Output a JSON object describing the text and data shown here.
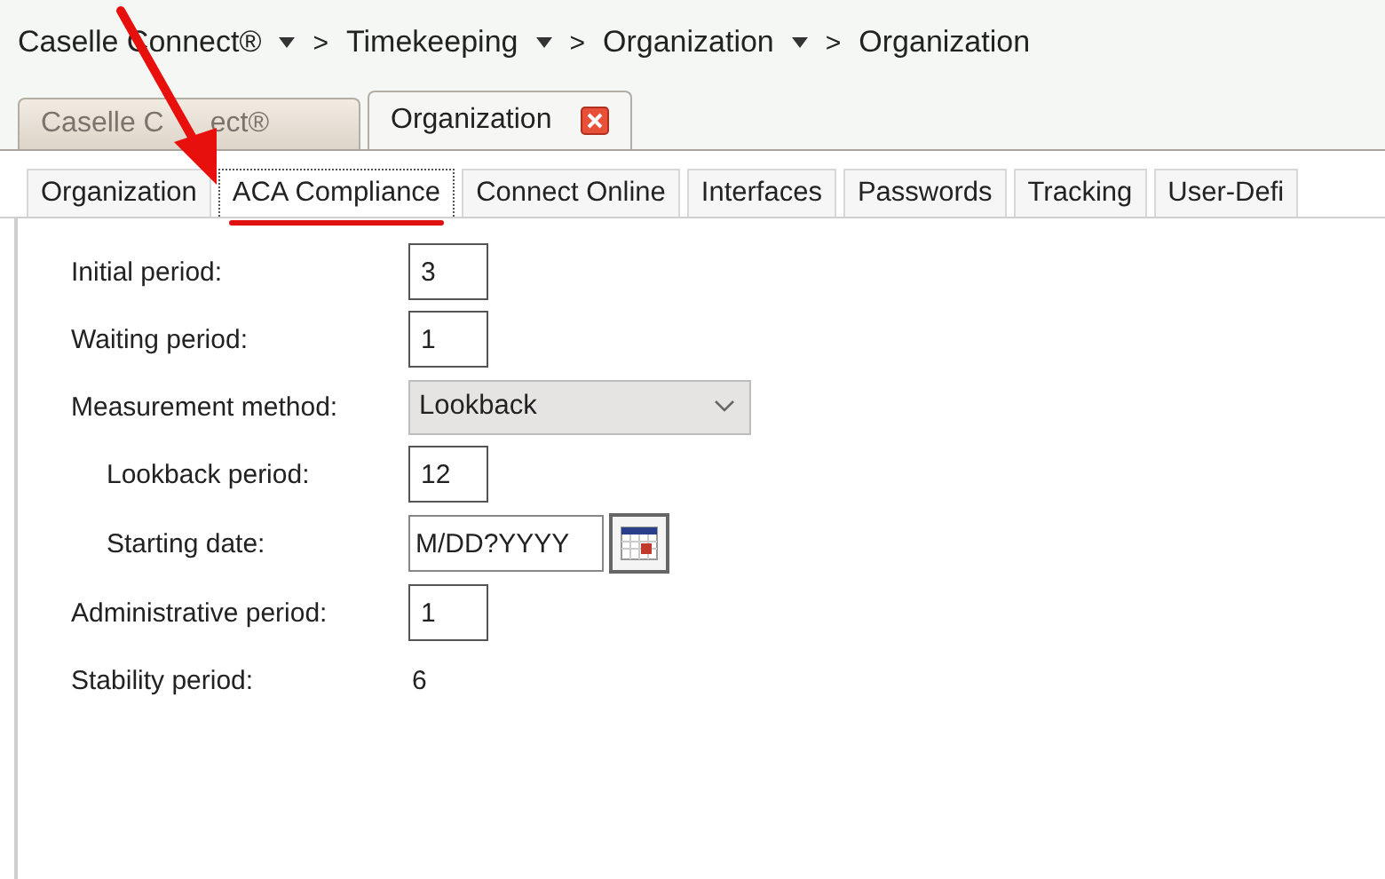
{
  "breadcrumb": [
    {
      "label": "Caselle Connect®",
      "menu": true,
      "separator": ">"
    },
    {
      "label": "Timekeeping",
      "menu": true,
      "separator": ">"
    },
    {
      "label": "Organization",
      "menu": true,
      "separator": ">"
    },
    {
      "label": "Organization",
      "menu": false
    }
  ],
  "document_tabs": [
    {
      "label_parts": [
        "Caselle C",
        "ect®"
      ],
      "selected": false,
      "closable": false
    },
    {
      "label": "Organization",
      "selected": true,
      "closable": true
    }
  ],
  "tabs": [
    {
      "label": "Organization",
      "selected": false,
      "highlighted": false
    },
    {
      "label": "ACA Compliance",
      "selected": true,
      "highlighted": true
    },
    {
      "label": "Connect Online",
      "selected": false,
      "highlighted": false
    },
    {
      "label": "Interfaces",
      "selected": false,
      "highlighted": false
    },
    {
      "label": "Passwords",
      "selected": false,
      "highlighted": false
    },
    {
      "label": "Tracking",
      "selected": false,
      "highlighted": false
    },
    {
      "label": "User-Defi",
      "selected": false,
      "highlighted": false
    }
  ],
  "form": [
    {
      "kind": "text",
      "label": "Initial period:",
      "value": "3"
    },
    {
      "kind": "text",
      "label": "Waiting period:",
      "value": "1"
    },
    {
      "kind": "select",
      "label": "Measurement method:",
      "value": "Lookback",
      "children": [
        {
          "kind": "text",
          "label": "Lookback period:",
          "value": "12"
        },
        {
          "kind": "date",
          "label": "Starting date:",
          "value": "M/DD?YYYY"
        }
      ]
    },
    {
      "kind": "text",
      "label": "Administrative period:",
      "value": "1"
    },
    {
      "kind": "static",
      "label": "Stability period:",
      "value": "6"
    }
  ],
  "annotation": {
    "arrow": true
  }
}
